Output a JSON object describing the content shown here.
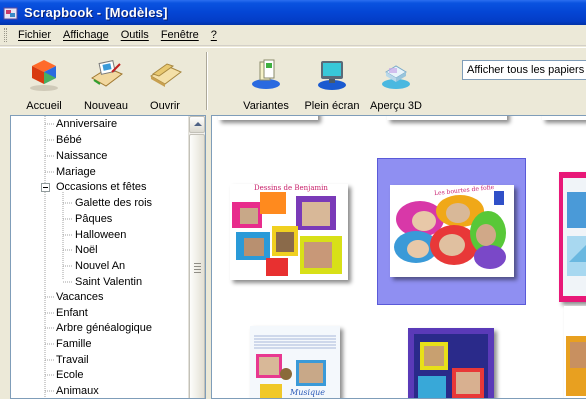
{
  "window": {
    "title": "Scrapbook - [Modèles]"
  },
  "menu": [
    {
      "label": "Fichier"
    },
    {
      "label": "Affichage"
    },
    {
      "label": "Outils"
    },
    {
      "label": "Fenêtre"
    },
    {
      "label": "?"
    }
  ],
  "toolbar": {
    "tools": [
      {
        "label": "Accueil",
        "icon": "home-cubes-icon"
      },
      {
        "label": "Nouveau",
        "icon": "new-project-icon"
      },
      {
        "label": "Ouvrir",
        "icon": "open-project-icon"
      },
      {
        "label": "Variantes",
        "icon": "variants-icon"
      },
      {
        "label": "Plein écran",
        "icon": "fullscreen-monitor-icon"
      },
      {
        "label": "Aperçu 3D",
        "icon": "preview-3d-icon"
      }
    ],
    "filter": {
      "selected": "Afficher tous les papiers"
    }
  },
  "tree": {
    "items": [
      {
        "label": "Anniversaire",
        "level": 0
      },
      {
        "label": "Bébé",
        "level": 0
      },
      {
        "label": "Naissance",
        "level": 0
      },
      {
        "label": "Mariage",
        "level": 0
      },
      {
        "label": "Occasions et fêtes",
        "level": 0,
        "expanded": true
      },
      {
        "label": "Galette des rois",
        "level": 1
      },
      {
        "label": "Pâques",
        "level": 1
      },
      {
        "label": "Halloween",
        "level": 1
      },
      {
        "label": "Noël",
        "level": 1
      },
      {
        "label": "Nouvel An",
        "level": 1
      },
      {
        "label": "Saint Valentin",
        "level": 1
      },
      {
        "label": "Vacances",
        "level": 0
      },
      {
        "label": "Enfant",
        "level": 0
      },
      {
        "label": "Arbre généalogique",
        "level": 0
      },
      {
        "label": "Famille",
        "level": 0
      },
      {
        "label": "Travail",
        "level": 0
      },
      {
        "label": "Ecole",
        "level": 0
      },
      {
        "label": "Animaux",
        "level": 0
      }
    ]
  },
  "gallery": {
    "thumbnails": [
      {
        "caption": "Dessins de Benjamin"
      },
      {
        "caption": "Les bourtes de fofie",
        "selected": true
      },
      {
        "caption": ""
      },
      {
        "caption": "Musique"
      },
      {
        "caption": ""
      },
      {
        "caption": ""
      }
    ]
  },
  "colors": {
    "titlebar": "#0445d4",
    "selection": "#8f8ff2",
    "panel_border": "#7f9db9"
  }
}
